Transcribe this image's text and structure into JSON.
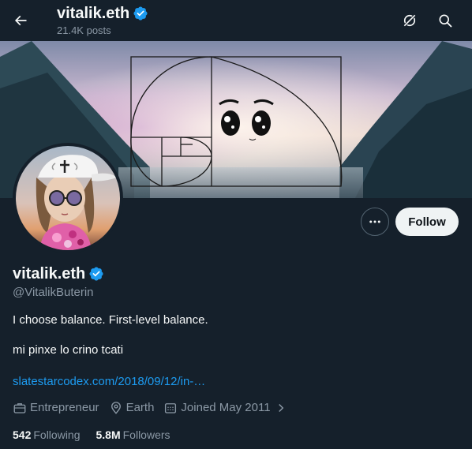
{
  "header": {
    "title": "vitalik.eth",
    "post_count": "21.4K posts"
  },
  "actions": {
    "follow_label": "Follow"
  },
  "profile": {
    "display_name": "vitalik.eth",
    "handle": "@VitalikButerin",
    "bio_line_1": "I choose balance. First-level balance.",
    "bio_line_2": "mi pinxe lo crino tcati",
    "link_text": "slatestarcodex.com/2018/09/12/in-…",
    "occupation": "Entrepreneur",
    "location": "Earth",
    "joined": "Joined May 2011"
  },
  "stats": {
    "following_count": "542",
    "following_label": "Following",
    "followers_count": "5.8M",
    "followers_label": "Followers"
  },
  "icons": {
    "back": "arrow-left-icon",
    "verified": "verified-badge-icon",
    "grok": "grok-icon",
    "search": "search-icon",
    "more": "more-dots-icon",
    "occupation": "briefcase-icon",
    "location": "location-pin-icon",
    "joined": "calendar-icon",
    "chevron": "chevron-right-icon"
  },
  "colors": {
    "background": "#15202b",
    "accent": "#1d9bf0",
    "secondary_text": "#8b98a5"
  }
}
